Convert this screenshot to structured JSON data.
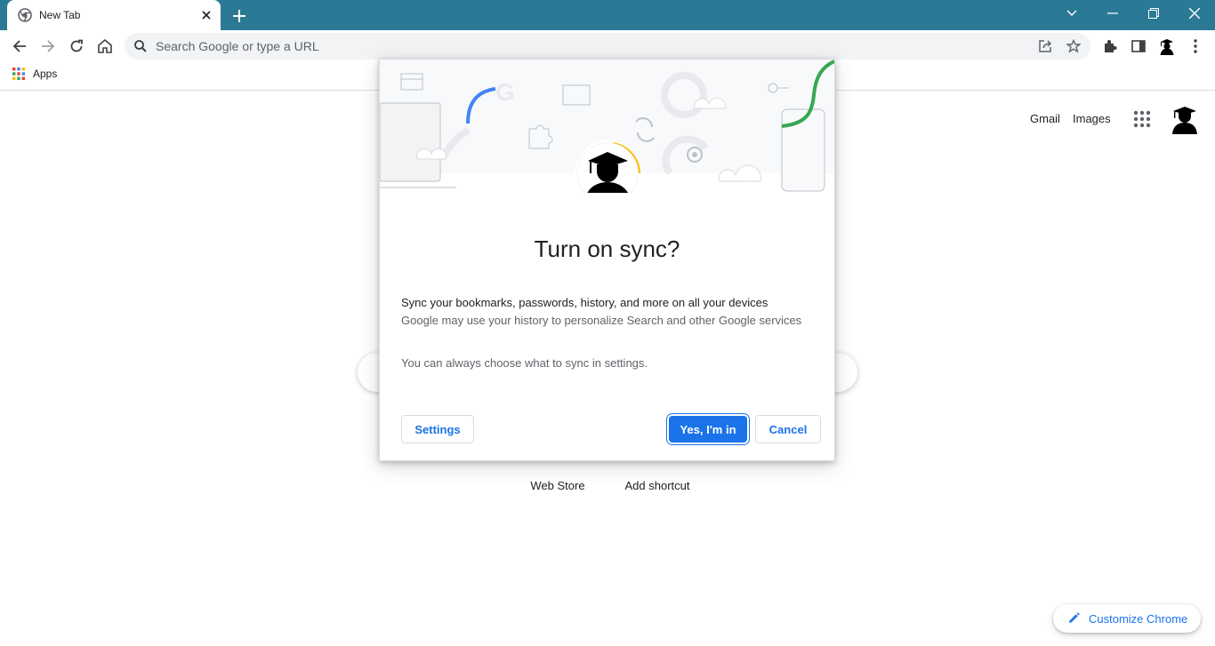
{
  "tab": {
    "title": "New Tab"
  },
  "omnibox": {
    "placeholder": "Search Google or type a URL"
  },
  "bookmarks": {
    "apps_label": "Apps"
  },
  "ntp": {
    "gmail": "Gmail",
    "images": "Images",
    "shortcuts": [
      "Web Store",
      "Add shortcut"
    ],
    "customize": "Customize Chrome"
  },
  "dialog": {
    "title": "Turn on sync?",
    "line1": "Sync your bookmarks, passwords, history, and more on all your devices",
    "line2": "Google may use your history to personalize Search and other Google services",
    "note": "You can always choose what to sync in settings.",
    "settings_label": "Settings",
    "confirm_label": "Yes, I'm in",
    "cancel_label": "Cancel"
  },
  "colors": {
    "titlebar": "#2b7a95",
    "accent": "#1a73e8"
  }
}
